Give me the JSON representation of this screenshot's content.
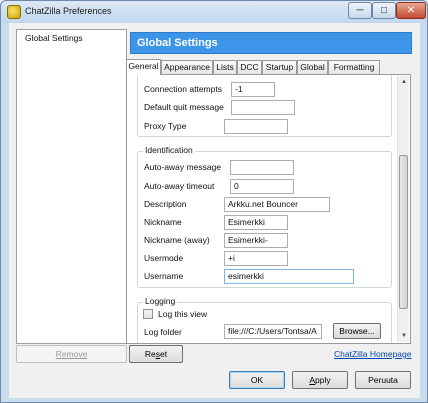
{
  "window": {
    "title": "ChatZilla Preferences",
    "controls": {
      "minimize": "─",
      "maximize": "□",
      "close": "✕"
    }
  },
  "sidebar": {
    "items": [
      {
        "label": "Global Settings"
      }
    ],
    "remove_button": {
      "prefix": "",
      "accel": "R",
      "rest": "emove"
    }
  },
  "header": {
    "title": "Global Settings",
    "color": "#3d95ea"
  },
  "tabs": [
    {
      "label": "General",
      "active": true
    },
    {
      "label": "Appearance"
    },
    {
      "label": "Lists"
    },
    {
      "label": "DCC"
    },
    {
      "label": "Startup"
    },
    {
      "label": "Global"
    },
    {
      "label": "Formatting"
    }
  ],
  "general": {
    "connection": {
      "connection_attempts": {
        "label": "Connection attempts",
        "value": "-1"
      },
      "default_quit_message": {
        "label": "Default quit message",
        "value": ""
      },
      "proxy_type": {
        "label": "Proxy Type",
        "value": ""
      }
    },
    "identification": {
      "legend": "Identification",
      "auto_away_message": {
        "label": "Auto-away message",
        "value": ""
      },
      "auto_away_timeout": {
        "label": "Auto-away timeout",
        "value": "0"
      },
      "description": {
        "label": "Description",
        "value": "Arkku.net Bouncer"
      },
      "nickname": {
        "label": "Nickname",
        "value": "Esimerkki"
      },
      "nickname_away": {
        "label": "Nickname (away)",
        "value": "Esimerkki-"
      },
      "usermode": {
        "label": "Usermode",
        "value": "+i"
      },
      "username": {
        "label": "Username",
        "value": "esimerkki"
      }
    },
    "logging": {
      "legend": "Logging",
      "log_this_view": {
        "label": "Log this view",
        "checked": false
      },
      "log_folder": {
        "label": "Log folder",
        "value": "file:///C:/Users/Tontsa/A"
      },
      "browse_button": "Browse..."
    }
  },
  "footer": {
    "reset_button": {
      "prefix": "Re",
      "accel": "s",
      "rest": "et"
    },
    "homepage_link": "ChatZilla Homepage",
    "ok_button": "OK",
    "apply_button": {
      "prefix": "",
      "accel": "A",
      "rest": "pply"
    },
    "cancel_button": "Peruuta"
  }
}
